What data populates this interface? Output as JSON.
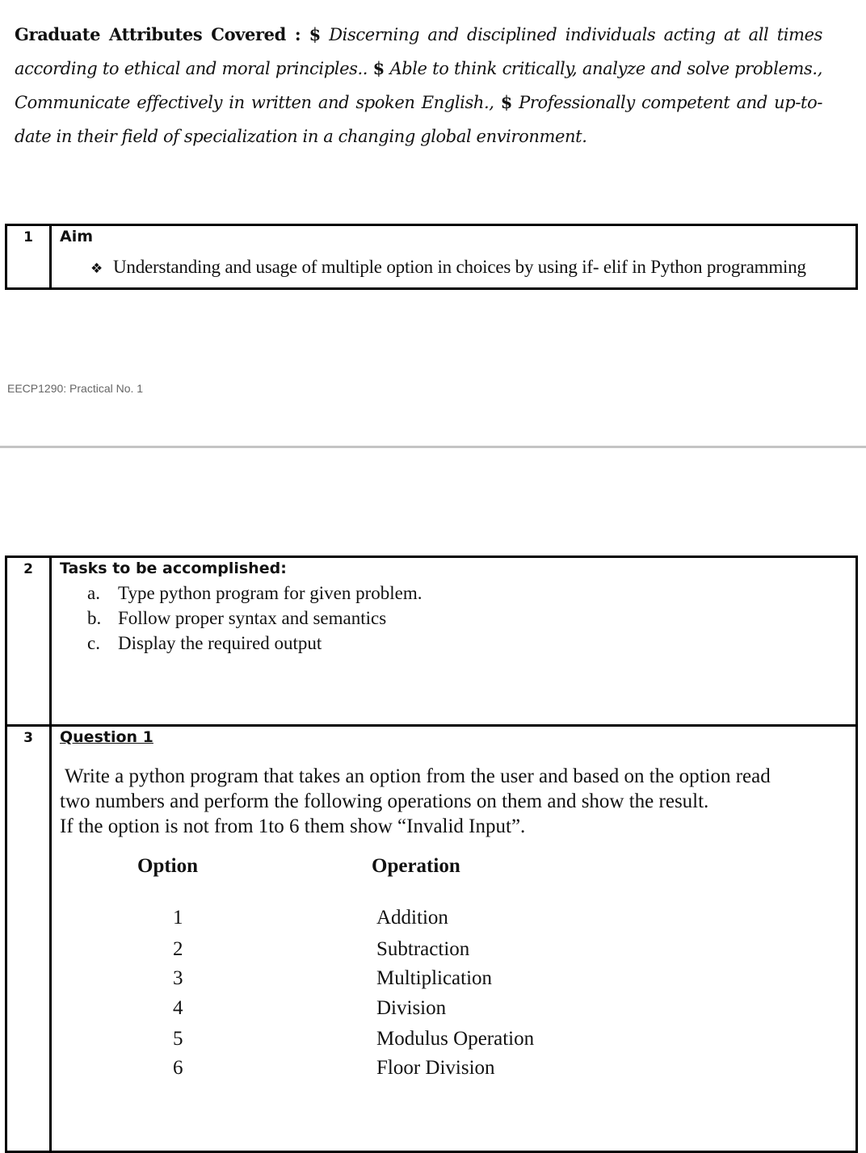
{
  "graduate_attributes": {
    "label": "Graduate Attributes Covered :",
    "items": [
      {
        "marker": "$",
        "text": "Discerning and disciplined individuals acting at all times according to ethical and moral principles.."
      },
      {
        "marker": "$",
        "text": "Able to think critically, analyze and solve problems., Communicate effectively in written and spoken English.,"
      },
      {
        "marker": "$",
        "text": "Professionally competent and up-to-date in their field of specialization in a changing global environment."
      }
    ]
  },
  "aim_section": {
    "number": "1",
    "heading": "Aim",
    "bullet_icon": "diamond-bullet",
    "bullet_glyph": "❖",
    "item": "Understanding and usage of multiple option in choices by using if- elif  in Python programming"
  },
  "page_footer": {
    "text": "EECP1290: Practical No. 1"
  },
  "tasks_section": {
    "number": "2",
    "heading": "Tasks to be accomplished:",
    "items": [
      {
        "marker": "a.",
        "text": "Type python program for given problem."
      },
      {
        "marker": "b.",
        "text": "Follow proper syntax and semantics"
      },
      {
        "marker": "c.",
        "text": "Display the required output"
      }
    ]
  },
  "question_section": {
    "number": "3",
    "heading": "Question 1",
    "body_lines": [
      "Write a python program that takes an option from the user and based on the option read",
      "two numbers and perform the following operations on them and show the result.",
      "If the option is not from 1to 6 them show “Invalid Input”."
    ],
    "table": {
      "headers": {
        "option": "Option",
        "operation": "Operation"
      },
      "rows": [
        {
          "option": "1",
          "operation": "Addition"
        },
        {
          "option": "2",
          "operation": "Subtraction"
        },
        {
          "option": "3",
          "operation": "Multiplication"
        },
        {
          "option": "4",
          "operation": "Division"
        },
        {
          "option": "5",
          "operation": "Modulus Operation"
        },
        {
          "option": "6",
          "operation": "Floor Division"
        }
      ]
    }
  }
}
